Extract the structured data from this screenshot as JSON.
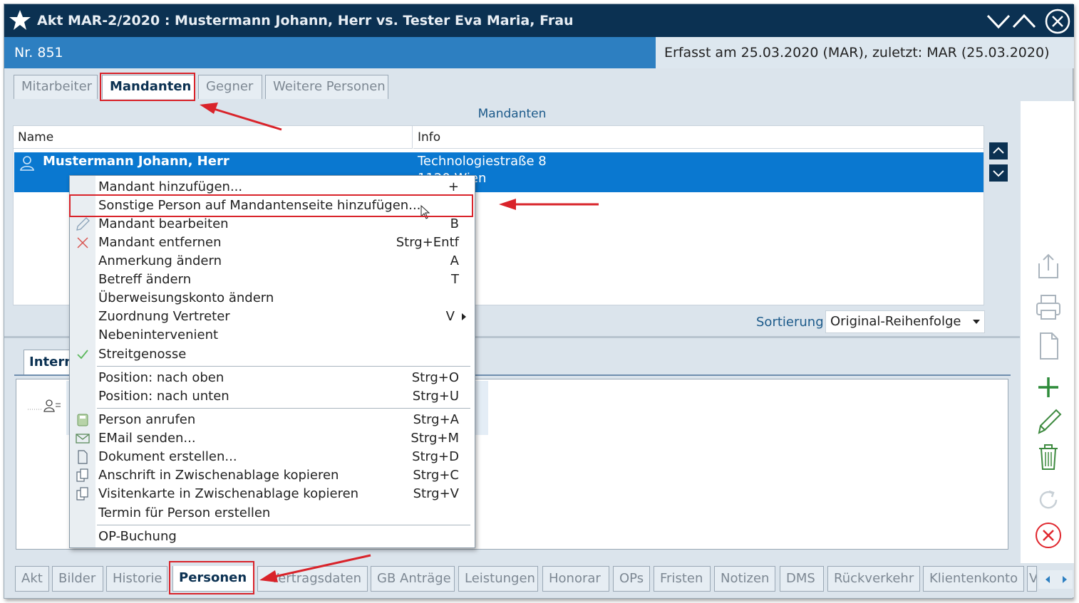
{
  "window": {
    "title": "Akt MAR-2/2020 : Mustermann Johann, Herr vs. Tester Eva Maria, Frau",
    "nr": "Nr. 851",
    "erfasst": "Erfasst am 25.03.2020 (MAR), zuletzt: MAR (25.03.2020)"
  },
  "top_tabs": [
    {
      "label": "Mitarbeiter"
    },
    {
      "label": "Mandanten"
    },
    {
      "label": "Gegner"
    },
    {
      "label": "Weitere Personen"
    }
  ],
  "mandanten": {
    "caption": "Mandanten",
    "col_name": "Name",
    "col_info": "Info",
    "rows": [
      {
        "name": "Mustermann Johann, Herr",
        "info_line1": "Technologiestraße 8",
        "info_line2": "1120 Wien"
      }
    ],
    "sort_label": "Sortierung",
    "sort_value": "Original-Reihenfolge"
  },
  "lower": {
    "tab_label": "Interne"
  },
  "context_menu": {
    "items": [
      {
        "label": "Mandant hinzufügen...",
        "shortcut": "+"
      },
      {
        "label": "Sonstige Person auf Mandantenseite hinzufügen...",
        "shortcut": ""
      },
      {
        "label": "Mandant bearbeiten",
        "shortcut": "B"
      },
      {
        "label": "Mandant entfernen",
        "shortcut": "Strg+Entf"
      },
      {
        "label": "Anmerkung ändern",
        "shortcut": "A"
      },
      {
        "label": "Betreff ändern",
        "shortcut": "T"
      },
      {
        "label": "Überweisungskonto ändern",
        "shortcut": ""
      },
      {
        "label": "Zuordnung Vertreter",
        "shortcut": "V"
      },
      {
        "label": "Nebenintervenient",
        "shortcut": ""
      },
      {
        "label": "Streitgenosse",
        "shortcut": ""
      },
      {
        "label": "Position: nach oben",
        "shortcut": "Strg+O"
      },
      {
        "label": "Position: nach unten",
        "shortcut": "Strg+U"
      },
      {
        "label": "Person anrufen",
        "shortcut": "Strg+A"
      },
      {
        "label": "EMail senden...",
        "shortcut": "Strg+M"
      },
      {
        "label": "Dokument erstellen...",
        "shortcut": "Strg+D"
      },
      {
        "label": "Anschrift in Zwischenablage kopieren",
        "shortcut": "Strg+C"
      },
      {
        "label": "Visitenkarte in Zwischenablage kopieren",
        "shortcut": "Strg+V"
      },
      {
        "label": "Termin für Person erstellen",
        "shortcut": ""
      },
      {
        "label": "OP-Buchung",
        "shortcut": ""
      }
    ]
  },
  "bottom_tabs": [
    {
      "label": "Akt"
    },
    {
      "label": "Bilder"
    },
    {
      "label": "Historie"
    },
    {
      "label": "Personen"
    },
    {
      "label": "Vertragsdaten"
    },
    {
      "label": "GB Anträge"
    },
    {
      "label": "Leistungen"
    },
    {
      "label": "Honorar"
    },
    {
      "label": "OPs"
    },
    {
      "label": "Fristen"
    },
    {
      "label": "Notizen"
    },
    {
      "label": "DMS"
    },
    {
      "label": "Rückverkehr"
    },
    {
      "label": "Klientenkonto"
    },
    {
      "label": "V"
    }
  ],
  "colors": {
    "title_bar": "#0b3152",
    "info_bar": "#2d7fc1",
    "selection": "#0a78d0",
    "highlight_box": "#d9232a",
    "add_icon": "#2e8b3a",
    "cancel_icon": "#e0262d"
  }
}
